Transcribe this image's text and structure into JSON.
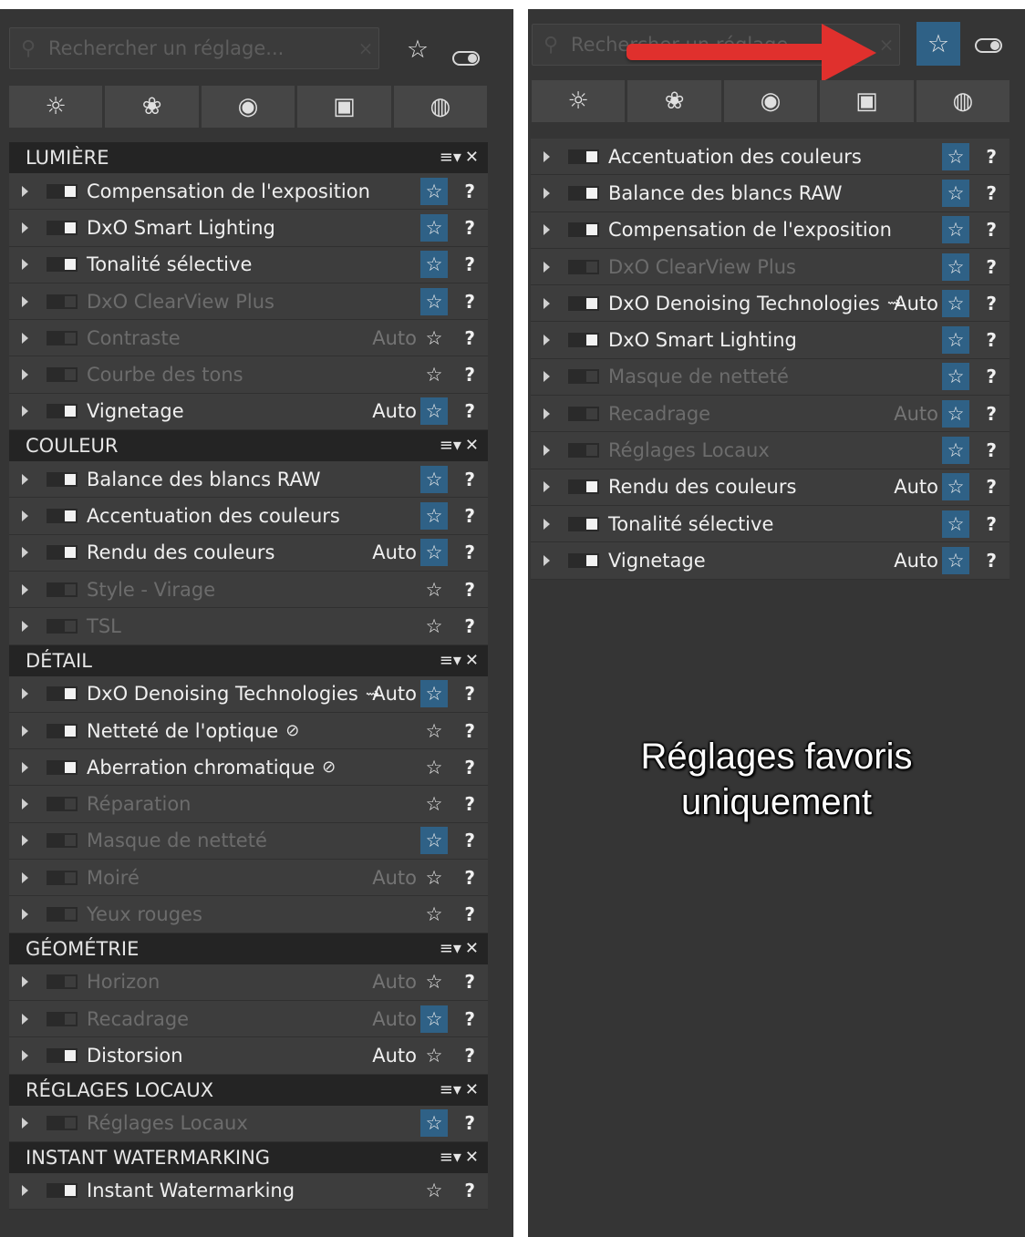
{
  "left_panel": {
    "search": {
      "placeholder": "Rechercher un réglage...",
      "clear_icon": "×"
    },
    "favorites_toggle": {
      "icon": "☆",
      "active": false
    },
    "tabs": [
      "☼",
      "❀",
      "◉",
      "▣",
      "◍"
    ],
    "sections": [
      {
        "title": "LUMIÈRE",
        "rows": [
          {
            "label": "Compensation de l'exposition",
            "on": true,
            "auto": "",
            "favorite": true
          },
          {
            "label": "DxO Smart Lighting",
            "on": true,
            "auto": "",
            "favorite": true
          },
          {
            "label": "Tonalité sélective",
            "on": true,
            "auto": "",
            "favorite": true
          },
          {
            "label": "DxO ClearView Plus",
            "on": false,
            "auto": "",
            "favorite": true
          },
          {
            "label": "Contraste",
            "on": false,
            "auto": "Auto",
            "favorite": false
          },
          {
            "label": "Courbe des tons",
            "on": false,
            "auto": "",
            "favorite": false
          },
          {
            "label": "Vignetage",
            "on": true,
            "auto": "Auto",
            "favorite": true
          }
        ]
      },
      {
        "title": "COULEUR",
        "rows": [
          {
            "label": "Balance des blancs RAW",
            "on": true,
            "auto": "",
            "favorite": true
          },
          {
            "label": "Accentuation des couleurs",
            "on": true,
            "auto": "",
            "favorite": true
          },
          {
            "label": "Rendu des couleurs",
            "on": true,
            "auto": "Auto",
            "favorite": true
          },
          {
            "label": "Style - Virage",
            "on": false,
            "auto": "",
            "favorite": false
          },
          {
            "label": "TSL",
            "on": false,
            "auto": "",
            "favorite": false
          }
        ]
      },
      {
        "title": "DÉTAIL",
        "rows": [
          {
            "label": "DxO Denoising Technologies",
            "on": true,
            "auto": "Auto",
            "favorite": true,
            "extra": "⇝"
          },
          {
            "label": "Netteté de l'optique",
            "on": true,
            "auto": "",
            "favorite": false,
            "extra": "⊘"
          },
          {
            "label": "Aberration chromatique",
            "on": true,
            "auto": "",
            "favorite": false,
            "extra": "⊘"
          },
          {
            "label": "Réparation",
            "on": false,
            "auto": "",
            "favorite": false
          },
          {
            "label": "Masque de netteté",
            "on": false,
            "auto": "",
            "favorite": true
          },
          {
            "label": "Moiré",
            "on": false,
            "auto": "Auto",
            "favorite": false
          },
          {
            "label": "Yeux rouges",
            "on": false,
            "auto": "",
            "favorite": false
          }
        ]
      },
      {
        "title": "GÉOMÉTRIE",
        "rows": [
          {
            "label": "Horizon",
            "on": false,
            "auto": "Auto",
            "favorite": false
          },
          {
            "label": "Recadrage",
            "on": false,
            "auto": "Auto",
            "favorite": true
          },
          {
            "label": "Distorsion",
            "on": true,
            "auto": "Auto",
            "favorite": false
          }
        ]
      },
      {
        "title": "RÉGLAGES LOCAUX",
        "rows": [
          {
            "label": "Réglages Locaux",
            "on": false,
            "auto": "",
            "favorite": true
          }
        ]
      },
      {
        "title": "INSTANT WATERMARKING",
        "rows": [
          {
            "label": "Instant Watermarking",
            "on": true,
            "auto": "",
            "favorite": false
          }
        ]
      }
    ]
  },
  "right_panel": {
    "search": {
      "placeholder": "Rechercher un réglage...",
      "clear_icon": "×"
    },
    "favorites_toggle": {
      "icon": "☆",
      "active": true
    },
    "tabs": [
      "☼",
      "❀",
      "◉",
      "▣",
      "◍"
    ],
    "rows": [
      {
        "label": "Accentuation des couleurs",
        "on": true,
        "auto": "",
        "favorite": true
      },
      {
        "label": "Balance des blancs RAW",
        "on": true,
        "auto": "",
        "favorite": true
      },
      {
        "label": "Compensation de l'exposition",
        "on": true,
        "auto": "",
        "favorite": true
      },
      {
        "label": "DxO ClearView Plus",
        "on": false,
        "auto": "",
        "favorite": true
      },
      {
        "label": "DxO Denoising Technologies",
        "on": true,
        "auto": "Auto",
        "favorite": true,
        "extra": "⇝"
      },
      {
        "label": "DxO Smart Lighting",
        "on": true,
        "auto": "",
        "favorite": true
      },
      {
        "label": "Masque de netteté",
        "on": false,
        "auto": "",
        "favorite": true
      },
      {
        "label": "Recadrage",
        "on": false,
        "auto": "Auto",
        "favorite": true
      },
      {
        "label": "Réglages Locaux",
        "on": false,
        "auto": "",
        "favorite": true
      },
      {
        "label": "Rendu des couleurs",
        "on": true,
        "auto": "Auto",
        "favorite": true
      },
      {
        "label": "Tonalité sélective",
        "on": true,
        "auto": "",
        "favorite": true
      },
      {
        "label": "Vignetage",
        "on": true,
        "auto": "Auto",
        "favorite": true
      }
    ],
    "caption": [
      "Réglages favoris",
      "uniquement"
    ]
  },
  "row_icons": {
    "star": "☆",
    "help": "?",
    "section_menu": "≡▾",
    "section_close": "✕"
  },
  "colors": {
    "panel_bg": "#353535",
    "row_bg": "#3d3d3d",
    "header_bg": "#242424",
    "favorite_accent": "#2f6186",
    "arrow": "#e0302d"
  }
}
